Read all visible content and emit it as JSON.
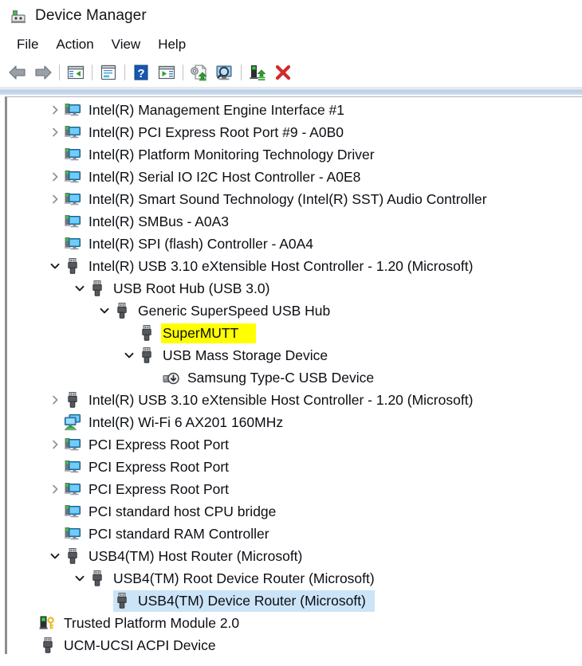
{
  "window": {
    "title": "Device Manager",
    "icon": "device-manager-icon"
  },
  "menubar": {
    "items": [
      {
        "label": "File",
        "name": "menu-file"
      },
      {
        "label": "Action",
        "name": "menu-action"
      },
      {
        "label": "View",
        "name": "menu-view"
      },
      {
        "label": "Help",
        "name": "menu-help"
      }
    ]
  },
  "toolbar": {
    "buttons": [
      {
        "icon": "back-arrow-icon",
        "tooltip": "Back"
      },
      {
        "icon": "forward-arrow-icon",
        "tooltip": "Forward"
      },
      {
        "icon": "show-hide-console-tree-icon",
        "tooltip": "Show/Hide Console Tree"
      },
      {
        "icon": "properties-icon",
        "tooltip": "Properties"
      },
      {
        "icon": "help-icon",
        "tooltip": "Help"
      },
      {
        "icon": "show-hide-action-pane-icon",
        "tooltip": "Show/Hide Action Pane"
      },
      {
        "icon": "update-driver-icon",
        "tooltip": "Update Driver Software"
      },
      {
        "icon": "scan-hardware-changes-icon",
        "tooltip": "Scan for hardware changes"
      },
      {
        "icon": "disable-device-icon",
        "tooltip": "Disable device"
      },
      {
        "icon": "uninstall-device-icon",
        "tooltip": "Uninstall device"
      }
    ],
    "separator_after": [
      1,
      2,
      3,
      5,
      7
    ]
  },
  "colors": {
    "highlight_yellow": "#ffff00",
    "selection_blue": "#cce4f7",
    "uninstall_red": "#d22b2b",
    "band_blue": "#b9cfe6"
  },
  "tree": {
    "rows": [
      {
        "label": "Intel(R) Management Engine Interface #1",
        "depth": 1,
        "twisty": "collapsed",
        "icon": "system-device-icon",
        "state": "normal"
      },
      {
        "label": "Intel(R) PCI Express Root Port #9 - A0B0",
        "depth": 1,
        "twisty": "collapsed",
        "icon": "system-device-icon",
        "state": "normal"
      },
      {
        "label": "Intel(R) Platform Monitoring Technology Driver",
        "depth": 1,
        "twisty": "none",
        "icon": "system-device-icon",
        "state": "normal"
      },
      {
        "label": "Intel(R) Serial IO I2C Host Controller - A0E8",
        "depth": 1,
        "twisty": "collapsed",
        "icon": "system-device-icon",
        "state": "normal"
      },
      {
        "label": "Intel(R) Smart Sound Technology (Intel(R) SST) Audio Controller",
        "depth": 1,
        "twisty": "collapsed",
        "icon": "system-device-icon",
        "state": "normal"
      },
      {
        "label": "Intel(R) SMBus - A0A3",
        "depth": 1,
        "twisty": "none",
        "icon": "system-device-icon",
        "state": "normal"
      },
      {
        "label": "Intel(R) SPI (flash) Controller - A0A4",
        "depth": 1,
        "twisty": "none",
        "icon": "system-device-icon",
        "state": "normal"
      },
      {
        "label": "Intel(R) USB 3.10 eXtensible Host Controller - 1.20 (Microsoft)",
        "depth": 1,
        "twisty": "expanded",
        "icon": "usb-device-icon",
        "state": "normal"
      },
      {
        "label": "USB Root Hub (USB 3.0)",
        "depth": 2,
        "twisty": "expanded",
        "icon": "usb-device-icon",
        "state": "normal"
      },
      {
        "label": "Generic SuperSpeed USB Hub",
        "depth": 3,
        "twisty": "expanded",
        "icon": "usb-device-icon",
        "state": "normal"
      },
      {
        "label": "SuperMUTT",
        "depth": 4,
        "twisty": "none",
        "icon": "usb-device-icon",
        "state": "highlight-yellow"
      },
      {
        "label": "USB Mass Storage Device",
        "depth": 4,
        "twisty": "expanded",
        "icon": "usb-device-icon",
        "state": "normal"
      },
      {
        "label": "Samsung Type-C USB Device",
        "depth": 5,
        "twisty": "none",
        "icon": "disk-drive-icon",
        "state": "normal"
      },
      {
        "label": "Intel(R) USB 3.10 eXtensible Host Controller - 1.20 (Microsoft)",
        "depth": 1,
        "twisty": "collapsed",
        "icon": "usb-device-icon",
        "state": "normal"
      },
      {
        "label": "Intel(R) Wi-Fi 6 AX201 160MHz",
        "depth": 1,
        "twisty": "none",
        "icon": "network-adapter-icon",
        "state": "normal"
      },
      {
        "label": "PCI Express Root Port",
        "depth": 1,
        "twisty": "collapsed",
        "icon": "system-device-icon",
        "state": "normal"
      },
      {
        "label": "PCI Express Root Port",
        "depth": 1,
        "twisty": "none",
        "icon": "system-device-icon",
        "state": "normal"
      },
      {
        "label": "PCI Express Root Port",
        "depth": 1,
        "twisty": "collapsed",
        "icon": "system-device-icon",
        "state": "normal"
      },
      {
        "label": "PCI standard host CPU bridge",
        "depth": 1,
        "twisty": "none",
        "icon": "system-device-icon",
        "state": "normal"
      },
      {
        "label": "PCI standard RAM Controller",
        "depth": 1,
        "twisty": "none",
        "icon": "system-device-icon",
        "state": "normal"
      },
      {
        "label": "USB4(TM) Host Router (Microsoft)",
        "depth": 1,
        "twisty": "expanded",
        "icon": "usb-device-icon",
        "state": "normal"
      },
      {
        "label": "USB4(TM) Root Device Router (Microsoft)",
        "depth": 2,
        "twisty": "expanded",
        "icon": "usb-device-icon",
        "state": "normal"
      },
      {
        "label": "USB4(TM) Device Router (Microsoft)",
        "depth": 3,
        "twisty": "none",
        "icon": "usb-device-icon",
        "state": "selected"
      },
      {
        "label": "Trusted Platform Module 2.0",
        "depth": 0,
        "twisty": "none",
        "icon": "security-device-icon",
        "state": "normal"
      },
      {
        "label": "UCM-UCSI ACPI Device",
        "depth": 0,
        "twisty": "none",
        "icon": "usb-device-icon",
        "state": "normal"
      }
    ]
  }
}
